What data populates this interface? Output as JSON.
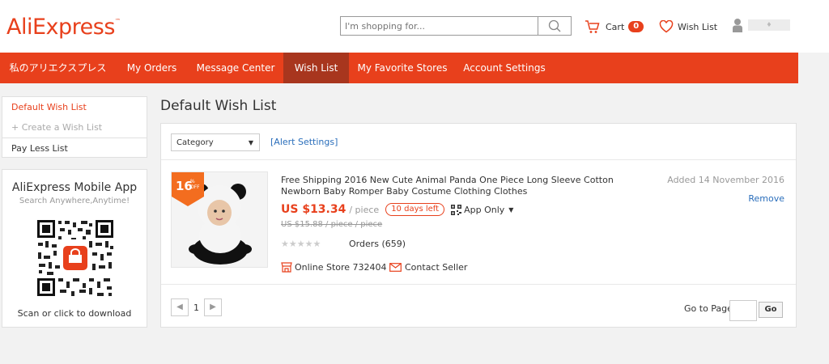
{
  "header": {
    "logo": "AliExpress",
    "logo_tm": "™",
    "search_placeholder": "I'm shopping for...",
    "cart_label": "Cart",
    "cart_count": "0",
    "wishlist_label": "Wish List",
    "user_name": "♦"
  },
  "nav": {
    "items": [
      "私のアリエクスプレス",
      "My Orders",
      "Message Center",
      "Wish List",
      "My Favorite Stores",
      "Account Settings"
    ],
    "active": "Wish List"
  },
  "sidebar": {
    "lists": [
      "Default Wish List",
      "+ Create a Wish List",
      "Pay Less List"
    ],
    "app_title": "AliExpress Mobile App",
    "app_subtitle": "Search Anywhere,Anytime!",
    "app_download": "Scan or click to download"
  },
  "main": {
    "title": "Default Wish List",
    "category_select": "Category",
    "alert_settings": "[Alert Settings]",
    "product": {
      "discount_pct": "16",
      "discount_sym": "%",
      "discount_off": "OFF",
      "name": "Free Shipping 2016 New Cute Animal Panda One Piece Long Sleeve Cotton Newborn Baby Romper Baby Costume Clothing Clothes",
      "price": "US $13.34",
      "unit": "/ piece",
      "days_left": "10 days left",
      "app_only": "App Only",
      "old_price": "US $15.88 / piece / piece",
      "stars": "★★★★★",
      "orders": "Orders (659)",
      "store": "Online Store 732404",
      "contact": "Contact Seller",
      "added": "Added 14 November 2016",
      "remove": "Remove"
    },
    "pager": {
      "prev": "◀",
      "page": "1",
      "next": "▶",
      "goto_label": "Go to Page",
      "go_button": "Go"
    }
  },
  "colors": {
    "brand": "#e8401c",
    "nav_active": "#a8361e",
    "link": "#2a6ebb"
  }
}
